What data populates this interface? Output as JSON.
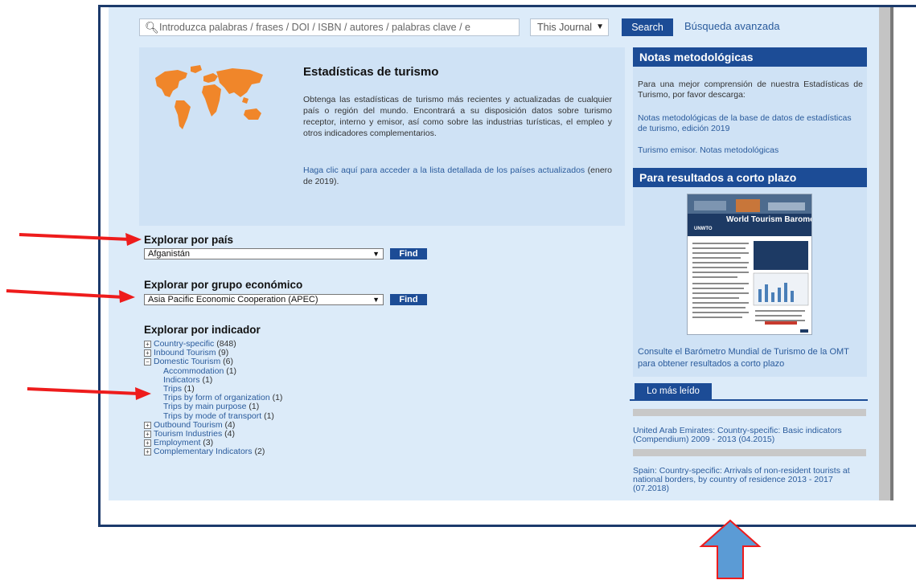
{
  "search": {
    "placeholder": "Introduzca palabras / frases / DOI / ISBN / autores / palabras clave / e",
    "scope": "This Journal",
    "button": "Search",
    "advanced": "Búsqueda avanzada"
  },
  "intro": {
    "title": "Estadísticas de turismo",
    "text": "Obtenga las estadísticas de turismo más recientes y actualizadas de cualquier país o región del mundo. Encontrará a su disposición datos sobre turismo receptor, interno y emisor, así como sobre las industrias turísticas, el empleo y otros indicadores complementarios.",
    "link_text": "Haga clic aquí para acceder a la lista detallada de los países actualizados",
    "link_suffix": " (enero de 2019)."
  },
  "explore": {
    "country_heading": "Explorar por país",
    "country_value": "Afganistán",
    "group_heading": "Explorar por grupo económico",
    "group_value": "Asia Pacific Economic Cooperation (APEC)",
    "find_label": "Find",
    "indicator_heading": "Explorar por indicador",
    "indicators": [
      {
        "label": "Country-specific",
        "count": "(848)",
        "sign": "+"
      },
      {
        "label": "Inbound Tourism",
        "count": "(9)",
        "sign": "+"
      },
      {
        "label": "Domestic Tourism",
        "count": "(6)",
        "sign": "−"
      },
      {
        "label": "Accommodation",
        "count": "(1)",
        "sub": true
      },
      {
        "label": "Indicators",
        "count": "(1)",
        "sub": true
      },
      {
        "label": "Trips",
        "count": "(1)",
        "sub": true
      },
      {
        "label": "Trips by form of organization",
        "count": "(1)",
        "sub": true
      },
      {
        "label": "Trips by main purpose",
        "count": "(1)",
        "sub": true
      },
      {
        "label": "Trips by mode of transport",
        "count": "(1)",
        "sub": true
      },
      {
        "label": "Outbound Tourism",
        "count": "(4)",
        "sign": "+"
      },
      {
        "label": "Tourism Industries",
        "count": "(4)",
        "sign": "+"
      },
      {
        "label": "Employment",
        "count": "(3)",
        "sign": "+"
      },
      {
        "label": "Complementary Indicators",
        "count": "(2)",
        "sign": "+"
      }
    ]
  },
  "notas": {
    "title": "Notas metodológicas",
    "text": "Para una mejor comprensión de nuestra Estadísticas de Turismo, por favor descarga:",
    "link1": "Notas metodológicas de la base de datos de estadísticas de turismo, edición 2019",
    "link2": "Turismo emisor. Notas metodológicas"
  },
  "corto": {
    "title": "Para resultados a corto plazo",
    "thumb_title": "World Tourism Barometer",
    "thumb_logo": "UNWTO",
    "link": "Consulte el Barómetro Mundial de Turismo de la OMT para obtener resultados a corto plazo"
  },
  "mas_leido": {
    "tab": "Lo más leído",
    "items": [
      "United Arab Emirates: Country-specific: Basic indicators (Compendium) 2009 - 2013 (04.2015)",
      "Spain: Country-specific: Arrivals of non-resident tourists at national borders, by country of residence 2013 - 2017 (07.2018)"
    ]
  },
  "colors": {
    "brand_blue": "#1c4c96",
    "page_bg": "#dcebf9",
    "map_orange": "#f0862a",
    "annotation_red": "#ee1c1c",
    "annotation_blue": "#5b9bd5"
  }
}
